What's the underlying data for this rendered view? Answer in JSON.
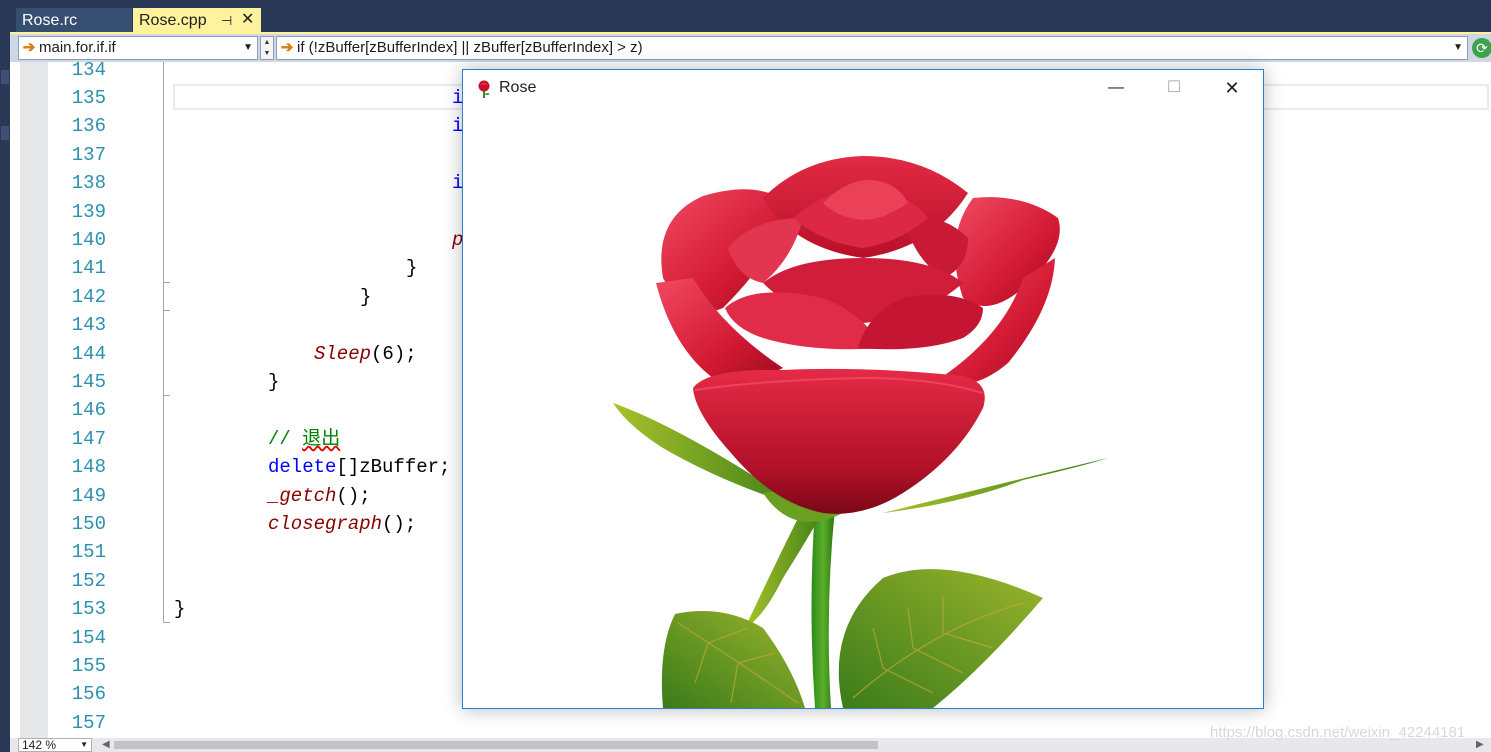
{
  "tabs": [
    {
      "label": "Rose.rc",
      "active": false
    },
    {
      "label": "Rose.cpp",
      "active": true
    }
  ],
  "tab_icons": {
    "pin": "pin-icon",
    "close": "close-icon"
  },
  "nav": {
    "scope": "main.for.if.if",
    "member": "if (!zBuffer[zBufferIndex] || zBuffer[zBufferIndex] > z)",
    "scope_icon": "arrow-right-icon",
    "refresh_icon": "refresh-icon"
  },
  "editor": {
    "line_numbers": [
      "134",
      "135",
      "136",
      "137",
      "138",
      "139",
      "140",
      "141",
      "142",
      "143",
      "144",
      "145",
      "146",
      "147",
      "148",
      "149",
      "150",
      "151",
      "152",
      "153",
      "154",
      "155",
      "156",
      "157"
    ],
    "visible_fragments": {
      "l135": "i",
      "l136": "i",
      "l138": "i",
      "l140": "p",
      "l141": "}",
      "l142": "}",
      "l144_fn": "Sleep",
      "l144_rest": "(6);",
      "l145": "}",
      "l147_prefix": "// ",
      "l147_text": "退出",
      "l148_kw": "delete",
      "l148_rest": "[]zBuffer;",
      "l149_fn": "_getch",
      "l149_rest": "();",
      "l150_fn": "closegraph",
      "l150_rest": "();",
      "l153": "}"
    }
  },
  "statusbar": {
    "zoom": "142 %"
  },
  "watermark": "https://blog.csdn.net/weixin_42244181",
  "rose_window": {
    "title": "Rose",
    "app_icon": "rose-icon",
    "minimize": "—",
    "maximize": "☐",
    "close": "✕"
  },
  "colors": {
    "vs_dark": "#293955",
    "active_tab": "#fff29d",
    "line_number": "#2b91af",
    "keyword": "#0000ff",
    "function": "#880000",
    "comment": "#008000",
    "window_border": "#2b7fd0",
    "petal": "#d81e3a",
    "leaf": "#7a9c1e"
  }
}
